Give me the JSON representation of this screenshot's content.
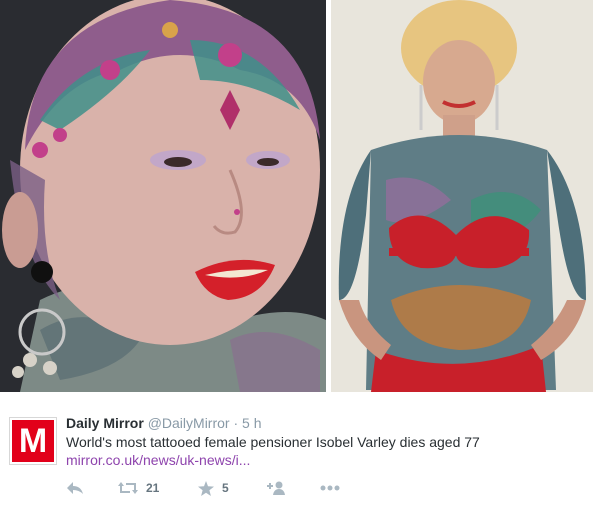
{
  "images": {
    "left_photo_icon": "portrait-photo",
    "right_photo_icon": "full-body-photo"
  },
  "tweet": {
    "avatar_letter": "M",
    "name": "Daily Mirror",
    "handle": "@DailyMirror",
    "separator": "·",
    "time": "5 h",
    "text": "World's most tattooed female pensioner Isobel Varley dies aged 77",
    "link": "mirror.co.uk/news/uk-news/i...",
    "retweets": "21",
    "favorites": "5"
  },
  "actions": {
    "reply_icon": "reply-icon",
    "retweet_icon": "retweet-icon",
    "favorite_icon": "star-icon",
    "follow_icon": "follow-icon",
    "more_icon": "more-icon"
  },
  "colors": {
    "brand_red": "#e2001a",
    "link": "#8e44ad",
    "muted": "#8899a6",
    "text": "#292f33"
  }
}
